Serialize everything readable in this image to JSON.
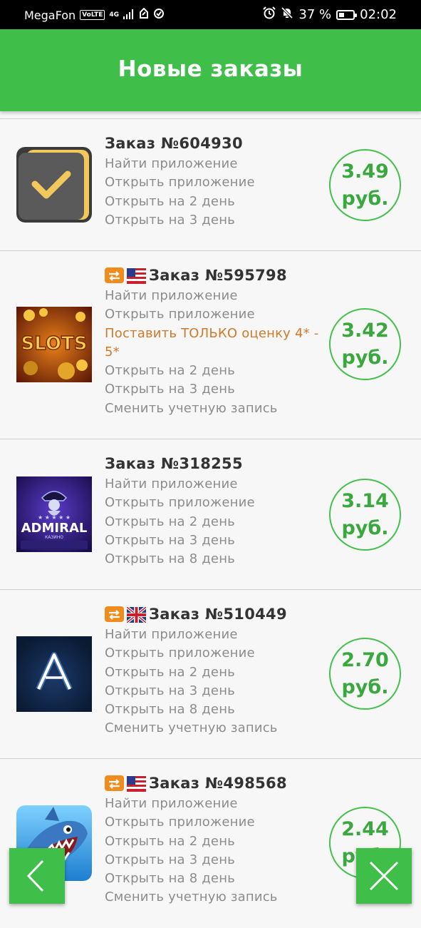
{
  "status_bar": {
    "carrier": "MegaFon",
    "volte": "VoLTE",
    "network": "4G",
    "battery_percent": "37 %",
    "battery_level": 0.37,
    "time": "02:02"
  },
  "header": {
    "title": "Новые заказы"
  },
  "orders": [
    {
      "title": "Заказ №604930",
      "badges": [],
      "icon": "checkmark-app-icon",
      "lines": [
        "Найти приложение",
        "Открыть приложение",
        "Открыть на 2 день",
        "Открыть на 3 день"
      ],
      "warning": "",
      "price_value": "3.49",
      "price_unit": "руб."
    },
    {
      "title": "Заказ №595798",
      "badges": [
        "repeat",
        "us-flag"
      ],
      "icon": "slots-app-icon",
      "icon_text": "SLOTS",
      "lines_before": [
        "Найти приложение",
        "Открыть приложение"
      ],
      "warning": "Поставить ТОЛЬКО оценку 4* - 5*",
      "lines_after": [
        "Открыть на 2 день",
        "Открыть на 3 день",
        "Сменить учетную запись"
      ],
      "price_value": "3.42",
      "price_unit": "руб."
    },
    {
      "title": "Заказ №318255",
      "badges": [],
      "icon": "admiral-casino-app-icon",
      "icon_text": "ADMIRAL",
      "icon_subtext": "КАЗИНО",
      "lines": [
        "Найти приложение",
        "Открыть приложение",
        "Открыть на 2 день",
        "Открыть на 3 день",
        "Открыть на 8 день"
      ],
      "warning": "",
      "price_value": "3.14",
      "price_unit": "руб."
    },
    {
      "title": "Заказ №510449",
      "badges": [
        "repeat",
        "uk-flag"
      ],
      "icon": "letter-a-app-icon",
      "lines": [
        "Найти приложение",
        "Открыть приложение",
        "Открыть на 2 день",
        "Открыть на 3 день",
        "Открыть на 8 день",
        "Сменить учетную запись"
      ],
      "warning": "",
      "price_value": "2.70",
      "price_unit": "руб."
    },
    {
      "title": "Заказ №498568",
      "badges": [
        "repeat",
        "us-flag"
      ],
      "icon": "shark-app-icon",
      "lines": [
        "Найти приложение",
        "Открыть приложение",
        "Открыть на 2 день",
        "Открыть на 3 день",
        "Открыть на 8 день",
        "Сменить учетную запись"
      ],
      "warning": "",
      "price_value": "2.44",
      "price_unit": "руб."
    }
  ],
  "buttons": {
    "back_icon": "chevron-left-icon",
    "close_icon": "close-icon"
  },
  "colors": {
    "accent_green": "#3fbf4a",
    "price_green": "#3aa83f",
    "warning_orange": "#cf7a2a"
  }
}
